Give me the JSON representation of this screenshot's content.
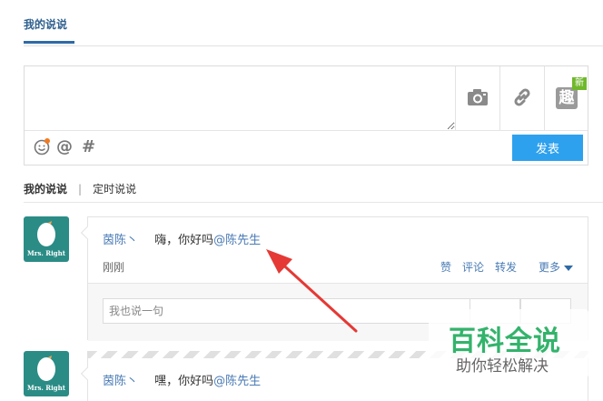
{
  "tabs": {
    "active": "我的说说"
  },
  "composer": {
    "placeholder": "",
    "tools": [
      "camera-icon",
      "link-icon",
      "fun-icon"
    ],
    "fun_label": "趣",
    "new_badge": "新",
    "bottom_tools": [
      "emoji-icon",
      "at-icon",
      "hashtag-icon"
    ],
    "at_label": "@",
    "hash_label": "#",
    "publish_label": "发表",
    "publish_color": "#2ea1ee"
  },
  "subtabs": {
    "mine": "我的说说",
    "separator": "|",
    "scheduled": "定时说说"
  },
  "avatar": {
    "label": "Mrs. Right",
    "bg_color": "#2b8c86"
  },
  "posts": [
    {
      "author": "茵陈丶",
      "text": "嗨，你好吗",
      "mention": "@陈先生",
      "time": "刚刚",
      "actions": {
        "like": "赞",
        "comment": "评论",
        "forward": "转发",
        "more": "更多"
      },
      "comment_placeholder": "我也说一句"
    },
    {
      "author": "茵陈丶",
      "text": "嘿，你好吗",
      "mention": "@陈先生"
    }
  ],
  "watermark": {
    "title": "百科全说",
    "subtitle": "助你轻松解决"
  },
  "colors": {
    "link": "#4a7bb5",
    "annotation_arrow": "#e53935",
    "watermark_green": "#33b36b"
  }
}
